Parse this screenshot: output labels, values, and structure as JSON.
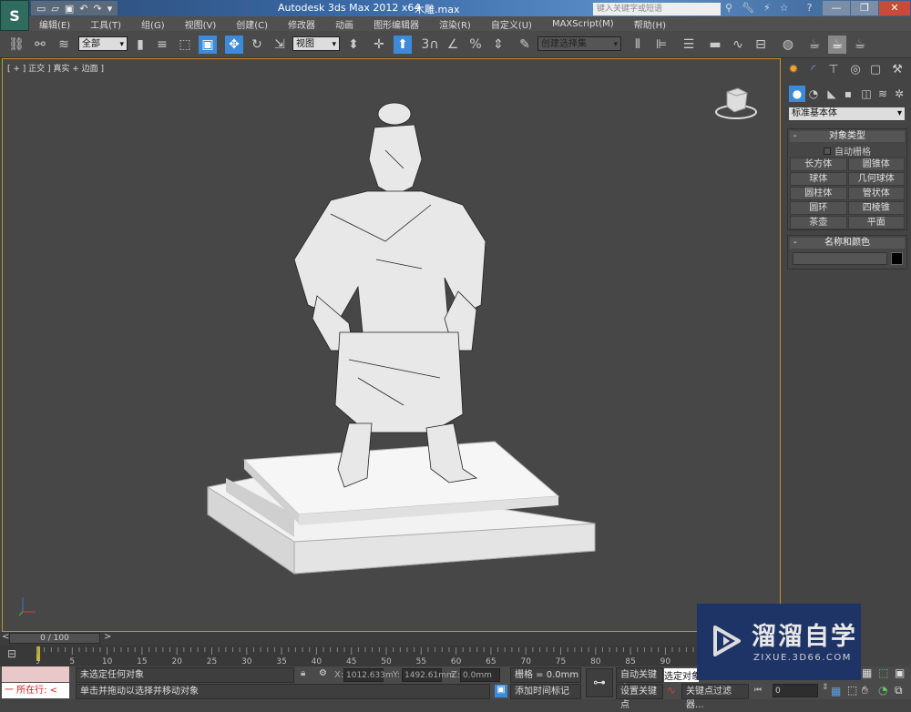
{
  "title_bar": {
    "app_title": "Autodesk 3ds Max  2012 x64",
    "file_name": "木雕.max",
    "search_placeholder": "键入关键字或短语"
  },
  "menu": [
    "编辑(E)",
    "工具(T)",
    "组(G)",
    "视图(V)",
    "创建(C)",
    "修改器",
    "动画",
    "图形编辑器",
    "渲染(R)",
    "自定义(U)",
    "MAXScript(M)",
    "帮助(H)"
  ],
  "toolbar": {
    "selection_filter": "全部",
    "reference_coord": "视图",
    "named_selection": "创建选择集",
    "snap_label": "3"
  },
  "viewport": {
    "label": "[ + ] 正交 ] 真实 + 边面 ]"
  },
  "command_panel": {
    "category": "标准基本体",
    "object_type_title": "对象类型",
    "auto_grid": "自动栅格",
    "auto_grid_checked": false,
    "buttons": [
      "长方体",
      "圆锥体",
      "球体",
      "几何球体",
      "圆柱体",
      "管状体",
      "圆环",
      "四棱锥",
      "茶壶",
      "平面"
    ],
    "name_color_title": "名称和颜色",
    "object_color": "#000000"
  },
  "time_slider": {
    "label": "0 / 100",
    "prev": "<",
    "next": ">"
  },
  "track_ticks": [
    "0",
    "5",
    "10",
    "15",
    "20",
    "25",
    "30",
    "35",
    "40",
    "45",
    "50",
    "55",
    "60",
    "65",
    "70",
    "75",
    "80",
    "85",
    "90"
  ],
  "status": {
    "listener_text": "一  所在行:  <",
    "selection_status": "未选定任何对象",
    "prompt": "单击并拖动以选择并移动对象",
    "x_label": "X:",
    "x_value": "1012.633m",
    "y_label": "Y:",
    "y_value": "1492.61mm",
    "z_label": "Z:",
    "z_value": "0.0mm",
    "grid": "栅格 = 0.0mm",
    "add_time_tag": "添加时间标记",
    "auto_key": "自动关键点",
    "selected_dropdown": "选定对象",
    "set_key": "设置关键点",
    "key_filters": "关键点过滤器...",
    "frame": "0"
  },
  "watermark": {
    "title": "溜溜自学",
    "url": "ZIXUE.3D66.COM"
  }
}
